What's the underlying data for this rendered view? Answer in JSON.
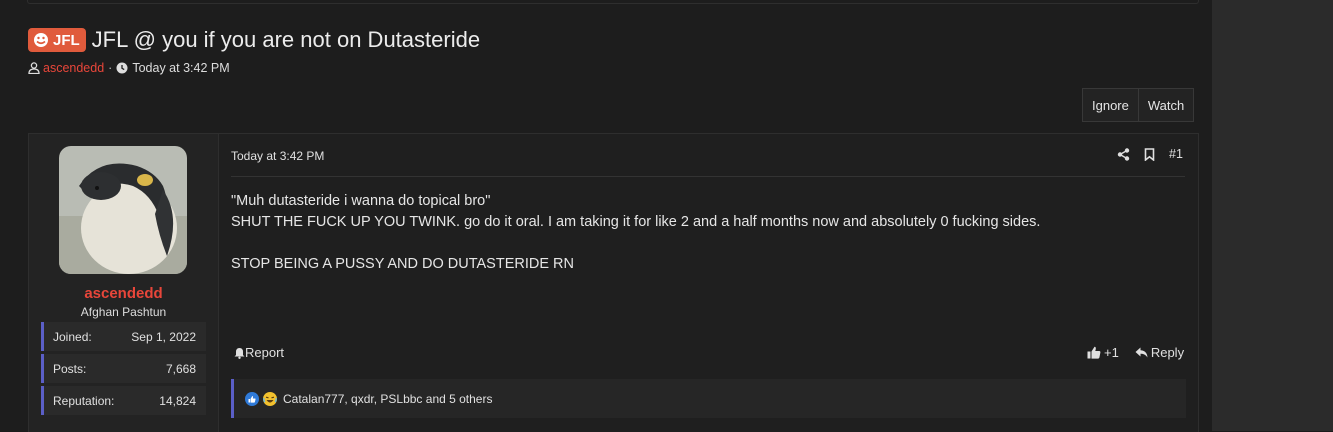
{
  "thread": {
    "prefix": "JFL",
    "title": "JFL @ you if you are not on Dutasteride",
    "author": "ascendedd",
    "separator": "·",
    "time": "Today at 3:42 PM"
  },
  "buttons": {
    "ignore": "Ignore",
    "watch": "Watch"
  },
  "post": {
    "user": {
      "name": "ascendedd",
      "title": "Afghan Pashtun",
      "stats": [
        {
          "label": "Joined:",
          "value": "Sep 1, 2022"
        },
        {
          "label": "Posts:",
          "value": "7,668"
        },
        {
          "label": "Reputation:",
          "value": "14,824"
        }
      ]
    },
    "date": "Today at 3:42 PM",
    "number": "#1",
    "body": {
      "line1": "\"Muh dutasteride i wanna do topical bro\"",
      "line2": "SHUT THE FUCK UP YOU TWINK. go do it oral. I am taking it for like 2 and a half months now and absolutely 0 fucking sides.",
      "line3": "STOP BEING A PUSSY AND DO DUTASTERIDE RN"
    },
    "report": "Report",
    "like_count": "+1",
    "reply": "Reply",
    "reactions_text": "Catalan777, qxdr, PSLbbc and 5 others"
  },
  "colors": {
    "accent_red": "#e8463a",
    "prefix_bg": "#e05b3c",
    "stat_border": "#5b5fc7"
  }
}
